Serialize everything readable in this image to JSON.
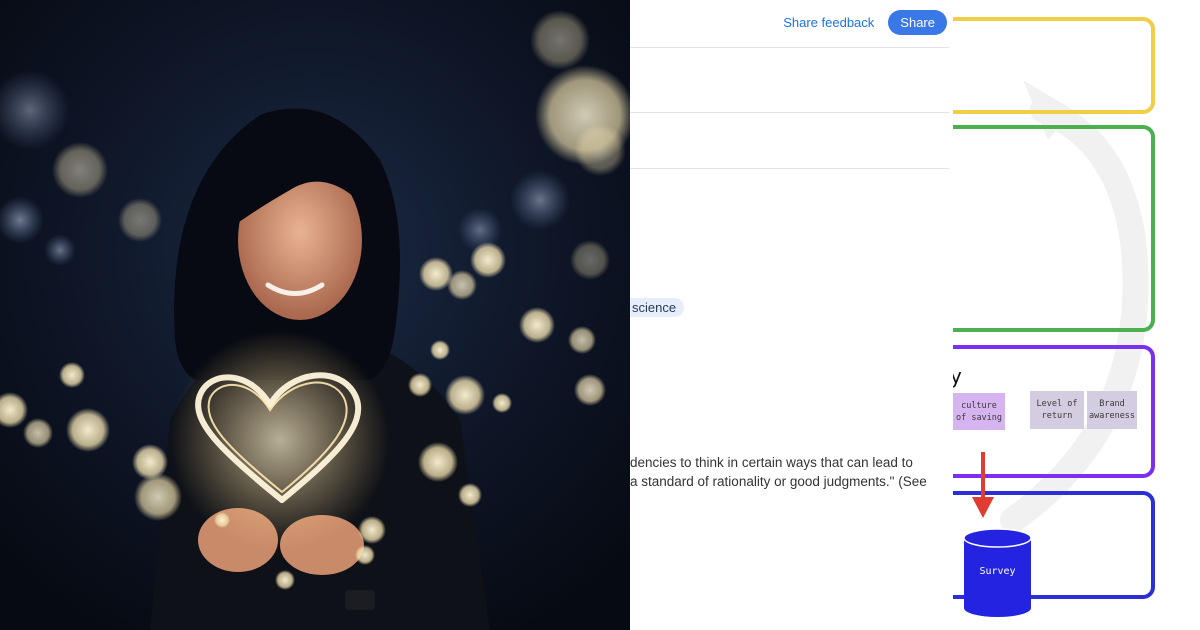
{
  "doc": {
    "feedback_label": "Share feedback",
    "share_label": "Share",
    "topic_chip": "science",
    "body_lines": [
      "dencies to think in certain ways that can lead to",
      "a standard of rationality or good judgments.\" (See"
    ]
  },
  "board": {
    "heading_fragment": "y",
    "stickies": [
      {
        "text": "culture of saving",
        "color": "#d6b4f0"
      },
      {
        "text": "Level of return",
        "color": "#d4cce0"
      },
      {
        "text": "Brand awareness",
        "color": "#d4cce0"
      }
    ],
    "database_label": "Survey",
    "box_colors": [
      "#f2cd4a",
      "#4caf50",
      "#7b2ff0",
      "#2b2fd6"
    ],
    "arrow_color": "#e03c31",
    "database_color": "#2424e0"
  },
  "photo": {
    "subject": "woman holding heart-shaped string lights at night",
    "icons": [
      "heart-lights-icon"
    ]
  }
}
